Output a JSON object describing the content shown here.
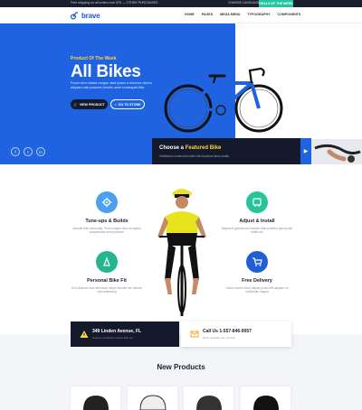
{
  "topbar": {
    "message": "Free shipping on all orders over $75 — OTHER PURCHASES",
    "language": "CHANGE LANGUAGE ▾",
    "cta": "DEALS OF THE WEEK"
  },
  "brand": {
    "name": "brave",
    "color": "#1f54d6"
  },
  "nav": [
    "HOME",
    "PAGES",
    "MEGA MENU",
    "TYPOGRAPHY",
    "COMPONENTS"
  ],
  "hero": {
    "tagline": "Product Of The Week",
    "title": "All Bikes",
    "description": "Fusce sem massa congue vitae ipsum a rhoncus viverra aliquam odio posuere lobortis amet consequat Bike",
    "primary_button": "VIEW PRODUCT",
    "secondary_button": "GO TO STORE",
    "socials": [
      "facebook-icon",
      "twitter-icon",
      "linkedin-icon"
    ],
    "featured_title_a": "Choose a",
    "featured_title_b": "Featured Bike",
    "featured_sub": "Vestibulum commodo mollis nibh faucibus lacus mattis",
    "colors": {
      "accent": "#1f63e0",
      "highlight": "#ffd23f",
      "dark": "#141a2b"
    }
  },
  "services": [
    {
      "title": "Tune-ups & Builds",
      "desc": "Aenean felis metus aliq. Proin conque dolor at sapien suspendisse enim posuere",
      "icon": "gear-icon",
      "color": "#4da0f0"
    },
    {
      "title": "Adjust & Install",
      "desc": "Magna et gravida sed lobortis vitae pharetra quis ipsum mattis dui",
      "icon": "tools-icon",
      "color": "#27c49a"
    },
    {
      "title": "Personal Bike Fit",
      "desc": "Sed placerat urna bibendum neque lobortis nec ultrices odio adipiscing",
      "icon": "bike-fit-icon",
      "color": "#26b58f"
    },
    {
      "title": "Free Delivery",
      "desc": "Donec lacinia elit ut aliquet porta velit aliquam eu sollicitudin magna",
      "icon": "cart-icon",
      "color": "#1f5fd6"
    }
  ],
  "contact": {
    "address": "349 Linden Avenue, FL",
    "address_sub": "Curious vestibulum lorem felis vel",
    "phone": "Call Us 1-557-846-9057",
    "phone_sub": "Nunc volutpat orci, sit amet"
  },
  "products": {
    "title": "New Products"
  }
}
